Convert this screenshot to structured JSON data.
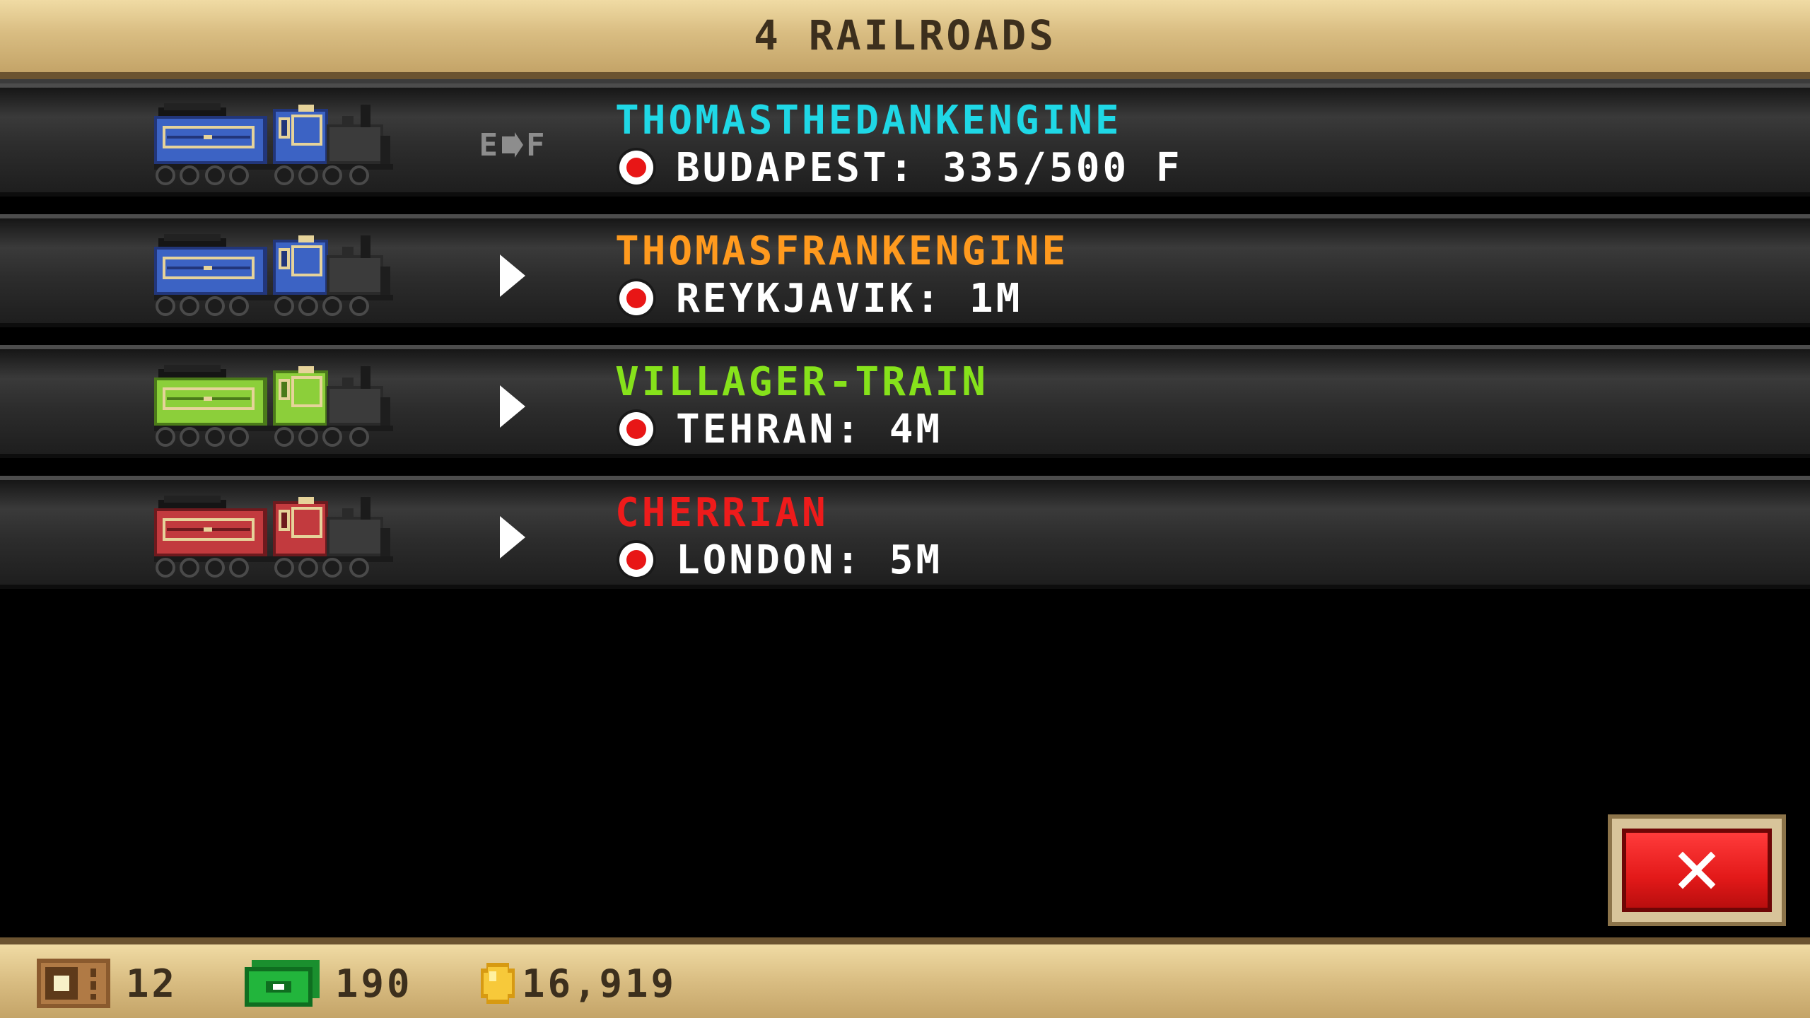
{
  "header": {
    "title": "4 RAILROADS"
  },
  "trains": [
    {
      "name": "THOMASTHEDANKENGINE",
      "name_color": "#1fd8e6",
      "color": "#3c63c4",
      "dark": "#22367a",
      "status": "fuel-gauge",
      "fuel_e": "E",
      "fuel_f": "F",
      "route": "BUDAPEST: 335/500 F"
    },
    {
      "name": "THOMASFRANKENGINE",
      "name_color": "#ff9a1e",
      "color": "#3c63c4",
      "dark": "#22367a",
      "status": "play",
      "route": "REYKJAVIK: 1M"
    },
    {
      "name": "VILLAGER-TRAIN",
      "name_color": "#86e21b",
      "color": "#8ccf3a",
      "dark": "#4b7a1a",
      "status": "play",
      "route": "TEHRAN: 4M"
    },
    {
      "name": "CHERRIAN",
      "name_color": "#ee1b1b",
      "color": "#c23a3e",
      "dark": "#6e1a1e",
      "status": "play",
      "route": "LONDON: 5M"
    }
  ],
  "close_button": {
    "label": "✕"
  },
  "footer": {
    "tickets": "12",
    "cash": "190",
    "coins": "16,919"
  }
}
